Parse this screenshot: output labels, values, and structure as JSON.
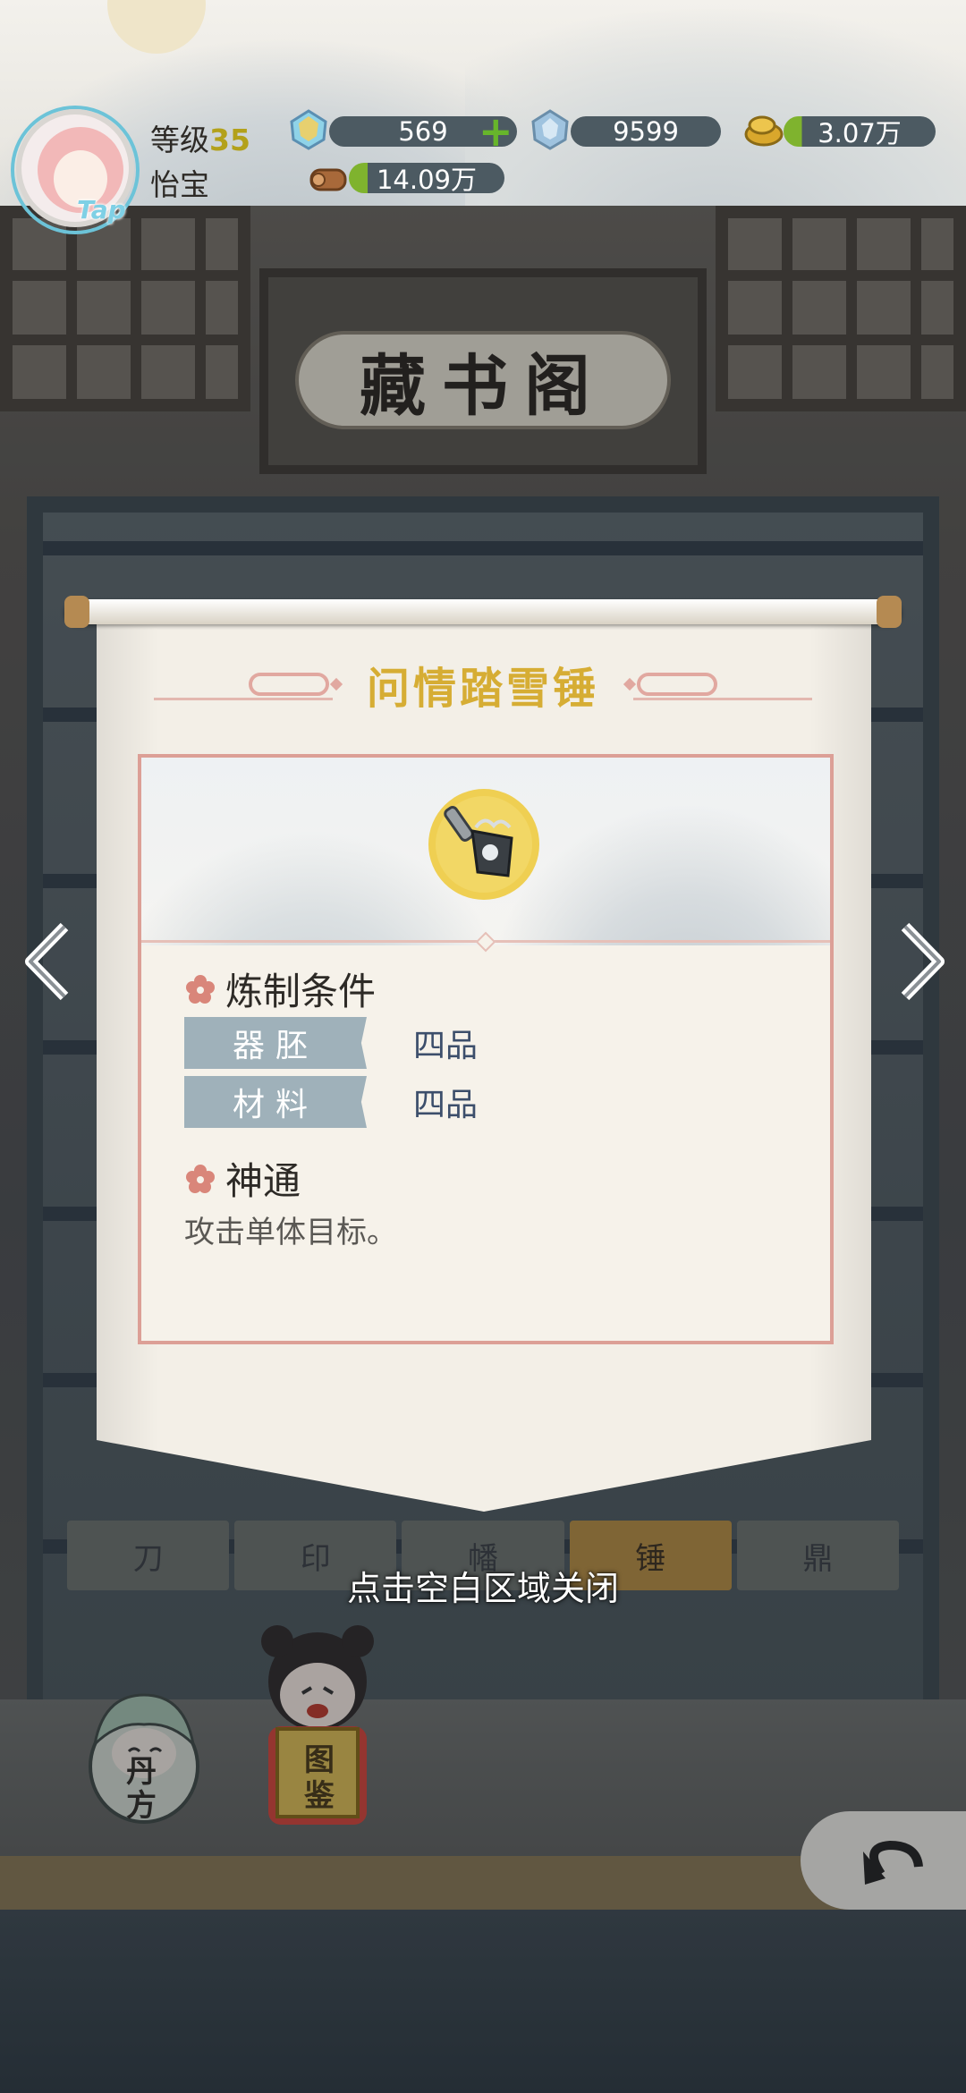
{
  "player": {
    "level_label": "等级",
    "level": "35",
    "name": "怡宝",
    "avatar_badge": "Tap"
  },
  "resources": {
    "crystal": "569",
    "diamond": "9599",
    "gold": "3.07万",
    "wood": "14.09万"
  },
  "hall": {
    "sign": "藏书阁",
    "tabs": [
      {
        "label": "刀",
        "active": false
      },
      {
        "label": "印",
        "active": false
      },
      {
        "label": "幡",
        "active": false
      },
      {
        "label": "锤",
        "active": true
      },
      {
        "label": "鼎",
        "active": false
      }
    ]
  },
  "detail": {
    "title": "问情踏雪锤",
    "item_icon": "hammer-icon",
    "requirements_heading": "炼制条件",
    "requirements": [
      {
        "label": "器胚",
        "value": "四品"
      },
      {
        "label": "材料",
        "value": "四品"
      }
    ],
    "skill_heading": "神通",
    "skill_desc": "攻击单体目标。"
  },
  "close_hint": "点击空白区域关闭",
  "bottom": {
    "danfang_label": "丹方",
    "tujian_label": "图鉴"
  },
  "colors": {
    "title_gold": "#d6ad34",
    "card_border": "#dc9f96",
    "req_label_bg": "#9fb1ba",
    "req_value": "#3c4e6b"
  }
}
